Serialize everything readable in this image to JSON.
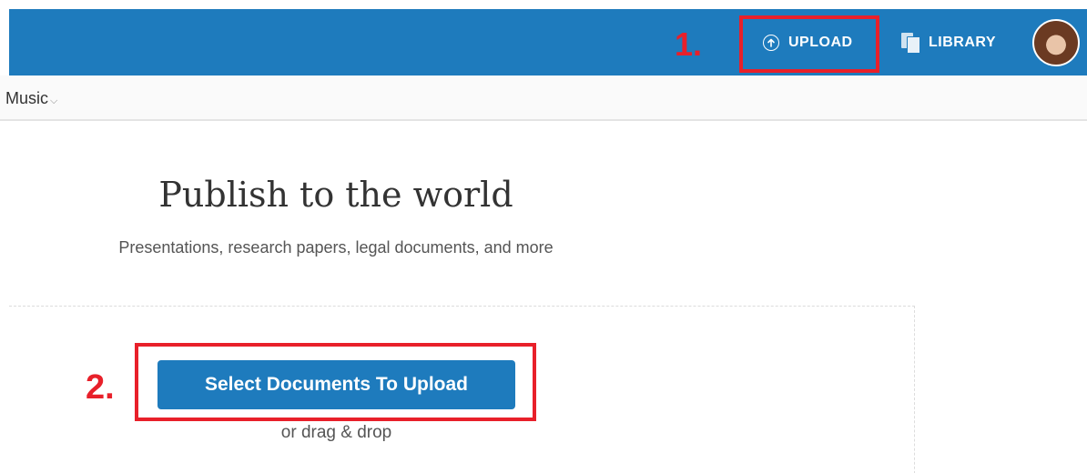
{
  "header": {
    "upload_label": "UPLOAD",
    "library_label": "LIBRARY",
    "upload_icon": "upload-circle-icon",
    "library_icon": "library-documents-icon",
    "brand_color": "#1e7bbd"
  },
  "categories": {
    "music_label": "Music"
  },
  "hero": {
    "title": "Publish to the world",
    "subtitle": "Presentations, research papers, legal documents, and more"
  },
  "upload_area": {
    "button_label": "Select Documents To Upload",
    "drag_text": "or drag & drop"
  },
  "annotations": {
    "step1": "1.",
    "step2": "2.",
    "color": "#e8202a"
  }
}
